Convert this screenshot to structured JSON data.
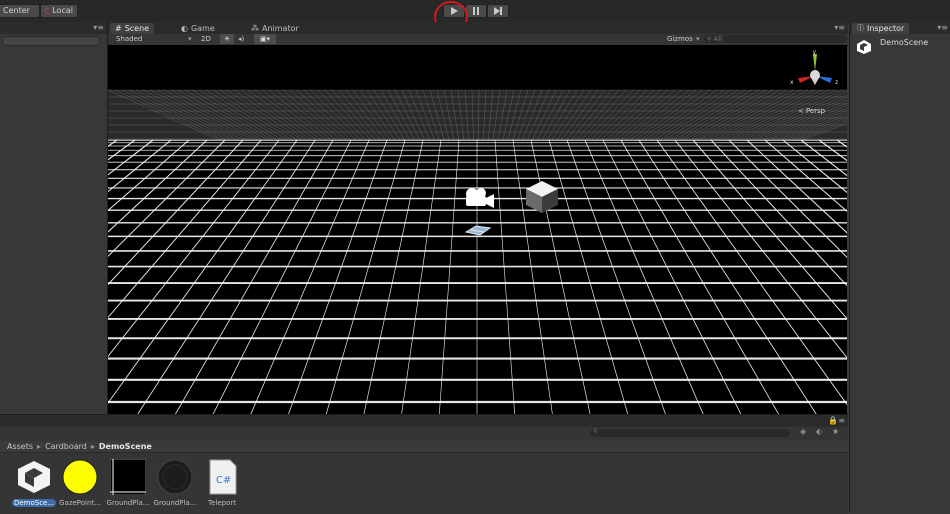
{
  "toolbar": {
    "pivot_label": "Center",
    "space_label": "Local",
    "play_icon": "play-icon",
    "pause_icon": "pause-icon",
    "step_icon": "step-icon",
    "highlight_color": "#d01a1a"
  },
  "scene_tabs": {
    "scene": "Scene",
    "game": "Game",
    "animator": "Animator"
  },
  "scene_toolbar": {
    "shading_mode": "Shaded",
    "mode_2d": "2D",
    "gizmos_label": "Gizmos",
    "search_placeholder": "All"
  },
  "viewport": {
    "gizmo_axes": {
      "y": "y",
      "x": "x",
      "z": "z"
    },
    "projection_label": "Persp",
    "background_color": "#000000",
    "grid_color": "#ffffff",
    "axis_colors": {
      "x": "#d22626",
      "y": "#8dc63f",
      "z": "#2e6cd8"
    }
  },
  "inspector": {
    "tab_label": "Inspector",
    "object_name": "DemoScene"
  },
  "project": {
    "breadcrumb": [
      "Assets",
      "Cardboard",
      "DemoScene"
    ],
    "assets": [
      {
        "label": "DemoSce...",
        "icon": "unity-scene-icon",
        "selected": true
      },
      {
        "label": "GazePoint...",
        "icon": "material-yellow-icon",
        "color": "#ffff00"
      },
      {
        "label": "GroundPla...",
        "icon": "grid-texture-icon"
      },
      {
        "label": "GroundPla...",
        "icon": "ground-material-icon"
      },
      {
        "label": "Teleport",
        "icon": "csharp-script-icon",
        "script_badge": "C#"
      }
    ]
  }
}
